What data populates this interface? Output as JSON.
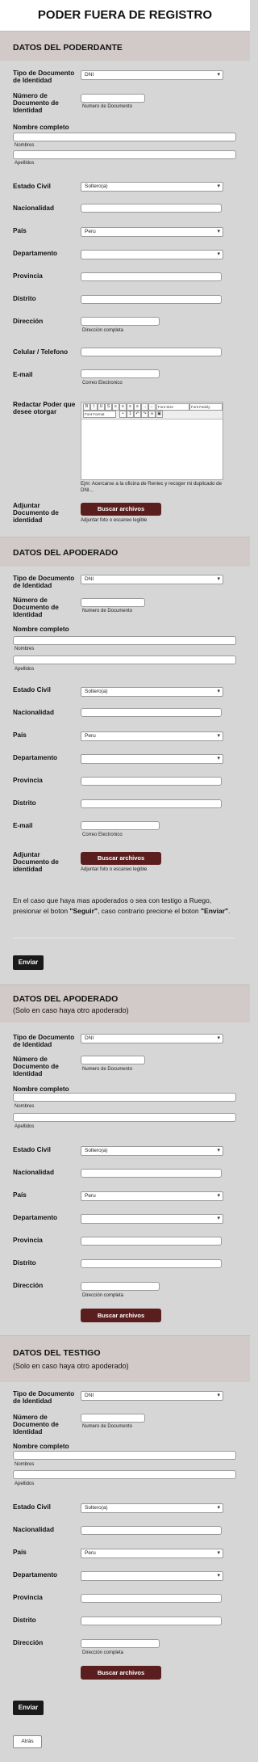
{
  "title": "PODER FUERA DE REGISTRO",
  "labels": {
    "doc_type": "Tipo de Documento de Identidad",
    "doc_number": "Número de Documento de Identidad",
    "full_name": "Nombre completo",
    "civil_status": "Estado Civil",
    "nationality": "Nacionalidad",
    "country": "País",
    "department": "Departamento",
    "province": "Provincia",
    "district": "Distrito",
    "address": "Dirección",
    "phone": "Celular / Telefono",
    "email": "E-mail",
    "draft": "Redactar Poder que desee otorgar",
    "attach": "Adjuntar Documento de identidad"
  },
  "hints": {
    "doc_number": "Numero de Documento",
    "names": "Nombres",
    "surnames": "Apellidos",
    "address": "Dirección completa",
    "email": "Correo Electronico",
    "attach": "Adjuntar foto o escaneo legible",
    "draft": "Ejm: Acercarse a la oficina de Reniec y recoger mi duplicado de DNI..."
  },
  "values": {
    "doc_type": "DNI",
    "civil_status": "Soltero(a)",
    "country": "Peru"
  },
  "editor": {
    "font_size": "Font Size",
    "font_family": "Font Family",
    "font_format": "Font Format"
  },
  "sections": {
    "poderdante": "DATOS DEL PODERDANTE",
    "apoderado": "DATOS DEL APODERADO",
    "apoderado2": "DATOS DEL APODERADO",
    "apoderado2_sub": "(Solo en caso haya otro apoderado)",
    "testigo": "DATOS DEL TESTIGO",
    "testigo_sub": "(Solo en caso haya otro apoderado)"
  },
  "note": {
    "pre": "En el caso que haya mas apoderados o sea con testigo a Ruego, presionar el boton ",
    "seguir": "\"Seguir\"",
    "mid": ", caso contrario precione el boton ",
    "enviar": "\"Enviar\"",
    "end": "."
  },
  "buttons": {
    "browse": "Buscar archivos",
    "send": "Enviar",
    "back": "Atrás"
  }
}
